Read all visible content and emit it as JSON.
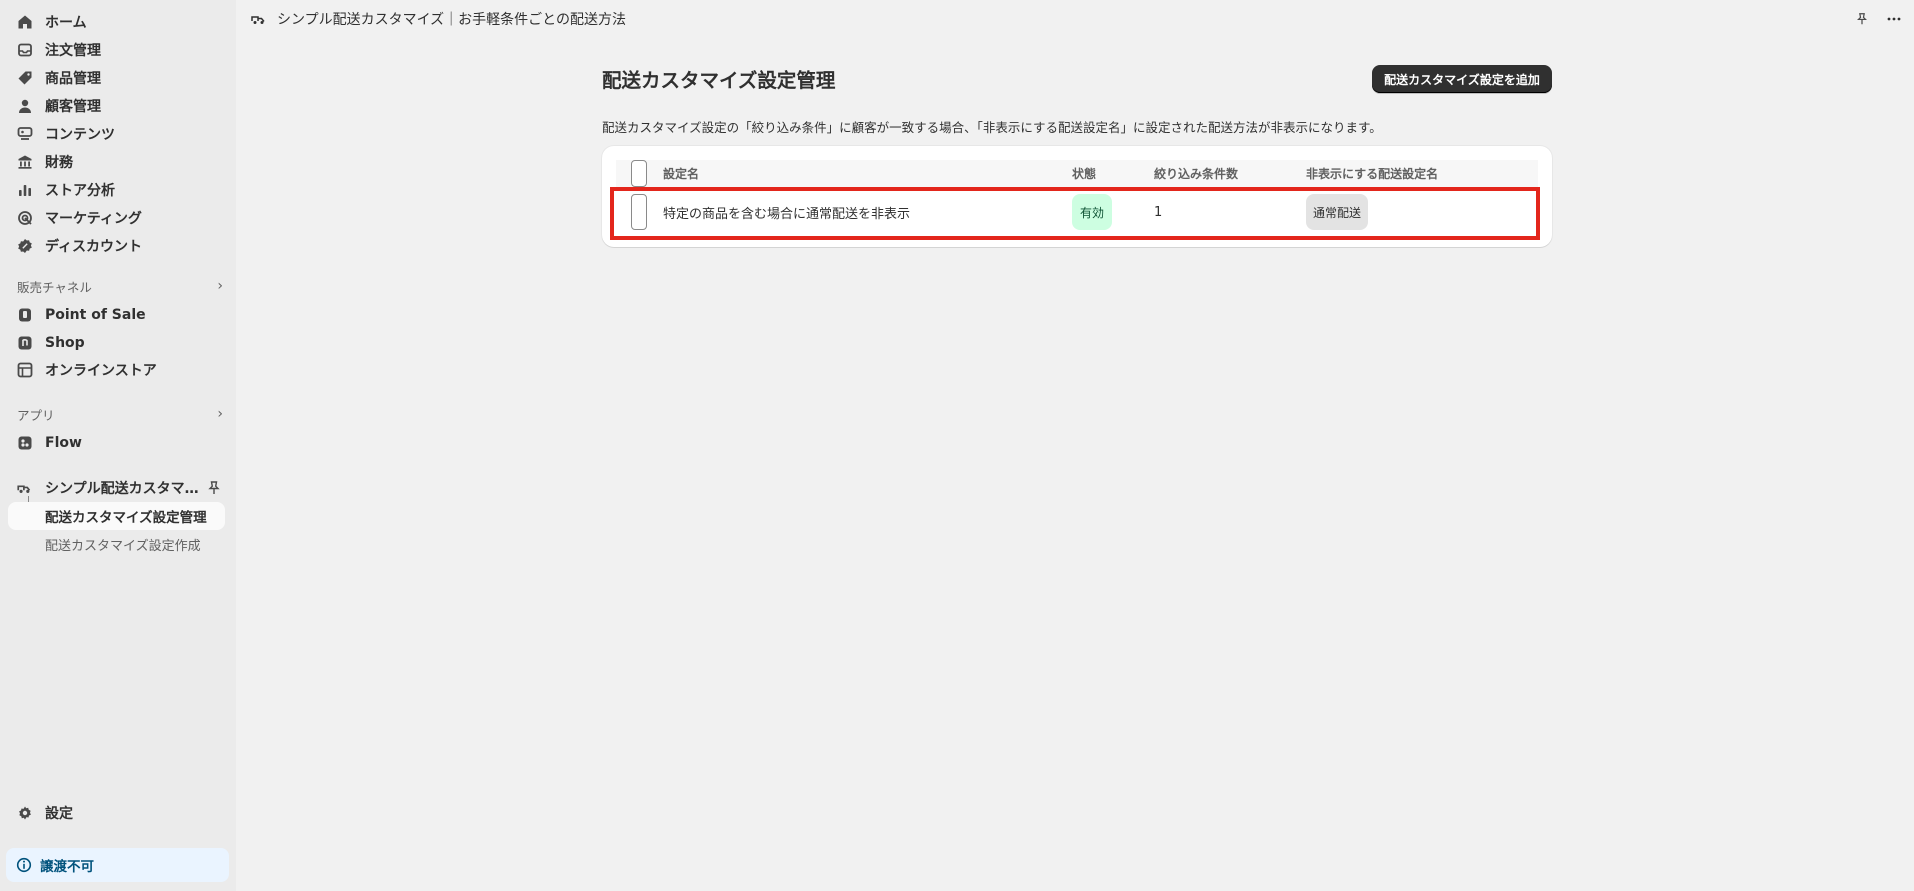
{
  "sidebar": {
    "items": [
      {
        "label": "ホーム",
        "icon": "home-icon"
      },
      {
        "label": "注文管理",
        "icon": "inbox-icon"
      },
      {
        "label": "商品管理",
        "icon": "tag-icon"
      },
      {
        "label": "顧客管理",
        "icon": "person-icon"
      },
      {
        "label": "コンテンツ",
        "icon": "content-icon"
      },
      {
        "label": "財務",
        "icon": "bank-icon"
      },
      {
        "label": "ストア分析",
        "icon": "chart-icon"
      },
      {
        "label": "マーケティング",
        "icon": "target-icon"
      },
      {
        "label": "ディスカウント",
        "icon": "discount-icon"
      }
    ],
    "sales_channels_label": "販売チャネル",
    "channels": [
      {
        "label": "Point of Sale",
        "icon": "pos-icon"
      },
      {
        "label": "Shop",
        "icon": "shop-icon"
      },
      {
        "label": "オンラインストア",
        "icon": "store-icon"
      }
    ],
    "apps_label": "アプリ",
    "apps": [
      {
        "label": "Flow",
        "icon": "flow-icon"
      }
    ],
    "app_parent_label": "シンプル配送カスタマイズ｜お手軽条件ごとの配送方法",
    "app_sub_active": "配送カスタマイズ設定管理",
    "app_sub_item": "配送カスタマイズ設定作成",
    "settings_label": "設定",
    "notice_label": "譲渡不可"
  },
  "topbar": {
    "title": "シンプル配送カスタマイズ｜お手軽条件ごとの配送方法"
  },
  "page": {
    "title": "配送カスタマイズ設定管理",
    "add_button": "配送カスタマイズ設定を追加",
    "description": "配送カスタマイズ設定の「絞り込み条件」に顧客が一致する場合、「非表示にする配送設定名」に設定された配送方法が非表示になります。"
  },
  "table": {
    "headers": [
      "設定名",
      "状態",
      "絞り込み条件数",
      "非表示にする配送設定名"
    ],
    "rows": [
      {
        "name": "特定の商品を含む場合に通常配送を非表示",
        "status": "有効",
        "count": "1",
        "hidden": "通常配送"
      }
    ]
  },
  "colors": {
    "accent": "#303030",
    "highlight": "#e3261c",
    "status_active_bg": "#cdfee1",
    "notice_bg": "#eaf4ff"
  }
}
